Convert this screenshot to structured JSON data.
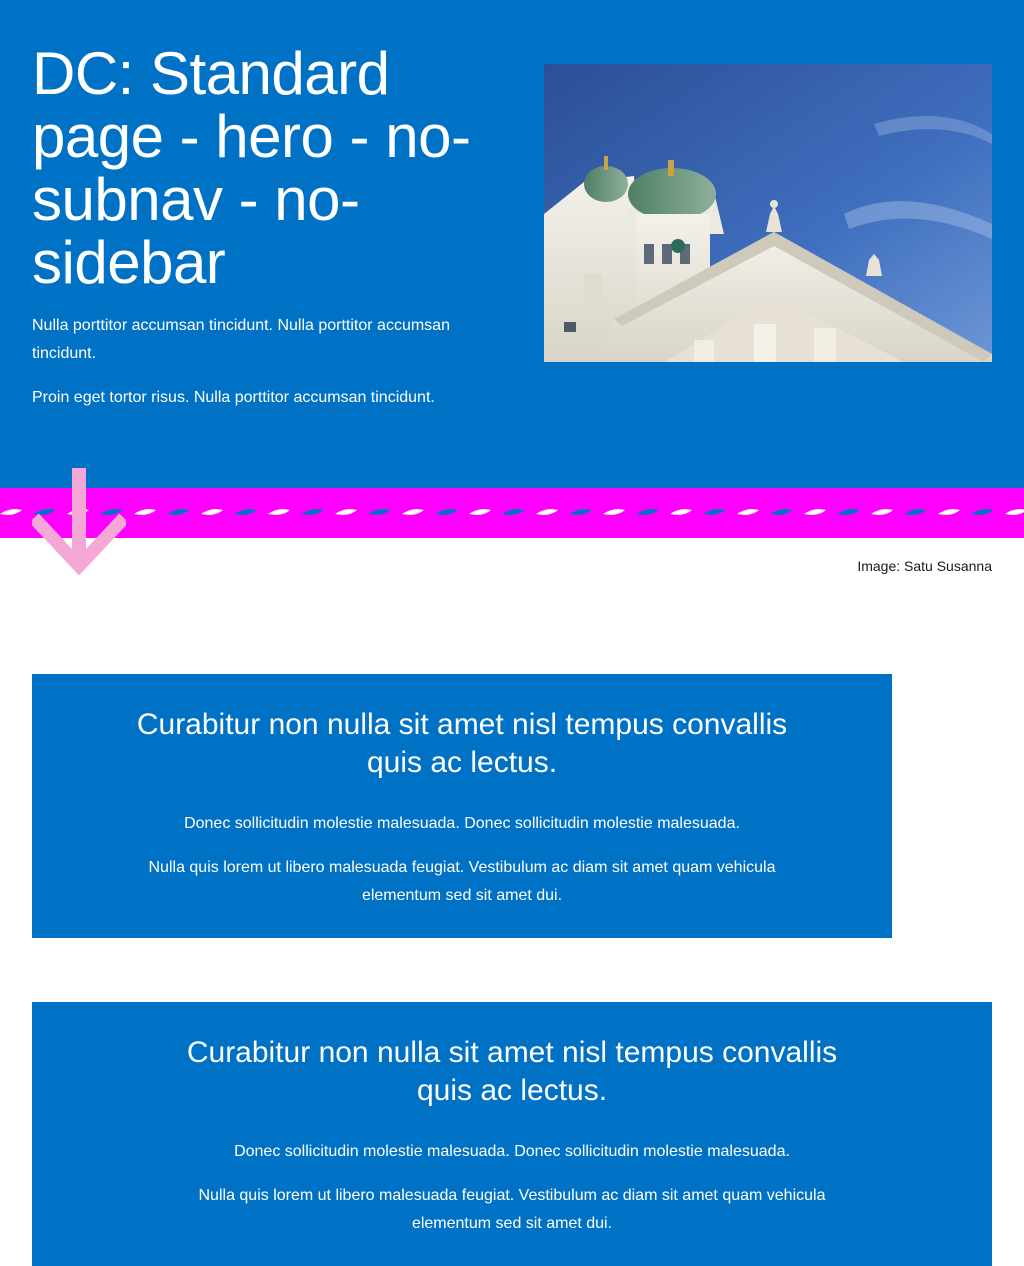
{
  "hero": {
    "title": "DC: Standard page - hero - no-subnav - no-sidebar",
    "paragraph_1": "Nulla porttitor accumsan tincidunt. Nulla porttitor accumsan tincidunt.",
    "paragraph_2": "Proin eget tortor risus. Nulla porttitor accumsan tincidunt.",
    "image_caption": "Image: Satu Susanna"
  },
  "banners": [
    {
      "title": "Curabitur non nulla sit amet nisl tempus convallis quis ac lectus.",
      "paragraph_1": "Donec sollicitudin molestie malesuada. Donec sollicitudin molestie malesuada.",
      "paragraph_2": "Nulla quis lorem ut libero malesuada feugiat. Vestibulum ac diam sit amet quam vehicula elementum sed sit amet dui."
    },
    {
      "title": "Curabitur non nulla sit amet nisl tempus convallis quis ac lectus.",
      "paragraph_1": "Donec sollicitudin molestie malesuada. Donec sollicitudin molestie malesuada.",
      "paragraph_2": "Nulla quis lorem ut libero malesuada feugiat. Vestibulum ac diam sit amet quam vehicula elementum sed sit amet dui."
    }
  ],
  "colors": {
    "hero_background": "#0072c6",
    "koro_background": "#ff00ff",
    "arrow": "#f5a8d6",
    "banner_background": "#0072c6"
  },
  "icons": {
    "scroll_arrow": "arrow-down-icon"
  }
}
